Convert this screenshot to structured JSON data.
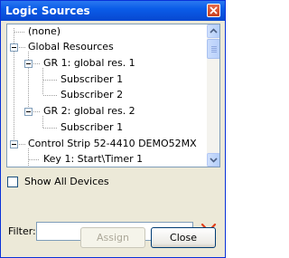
{
  "window": {
    "title": "Logic Sources"
  },
  "tree": {
    "items": [
      {
        "label": "(none)"
      },
      {
        "label": "Global Resources"
      },
      {
        "label": "GR 1: global res. 1"
      },
      {
        "label": "Subscriber 1"
      },
      {
        "label": "Subscriber 2"
      },
      {
        "label": "GR 2: global res. 2"
      },
      {
        "label": "Subscriber 1"
      },
      {
        "label": "Control Strip 52-4410 DEMO52MX"
      },
      {
        "label": "Key 1: Start\\Timer 1"
      }
    ]
  },
  "options": {
    "show_all_devices_label": "Show All Devices",
    "show_all_devices_checked": false
  },
  "filter": {
    "label": "Filter:",
    "value": ""
  },
  "buttons": {
    "assign": "Assign",
    "close": "Close"
  },
  "icons": {
    "close": "close-icon",
    "clear_filter": "red-x-icon"
  },
  "colors": {
    "titlebar": "#0a5ce8",
    "dialog": "#ece9d8",
    "clear_x": "#e0401c"
  }
}
